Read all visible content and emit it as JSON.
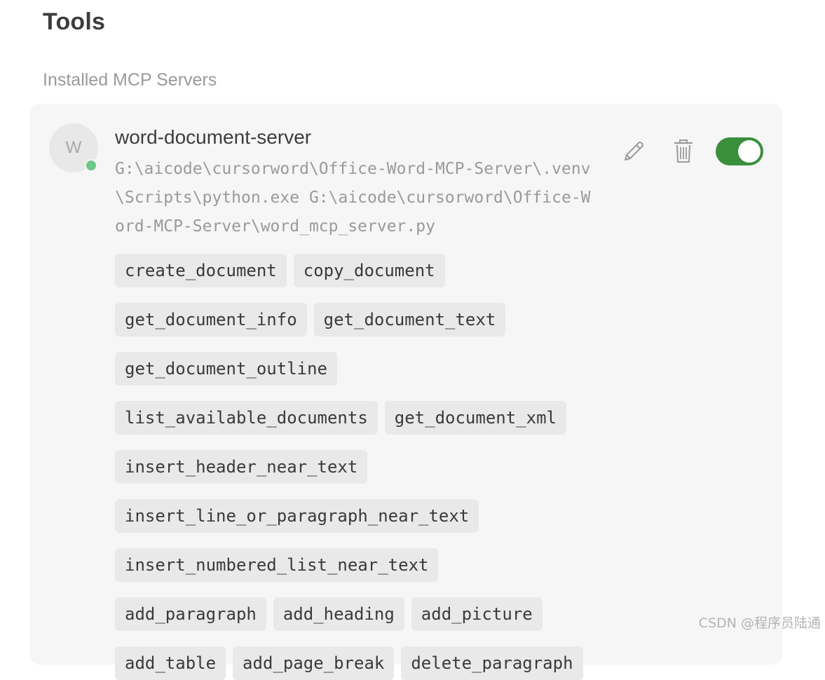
{
  "page": {
    "title": "Tools",
    "section_label": "Installed MCP Servers"
  },
  "server": {
    "avatar_letter": "W",
    "status": "online",
    "name": "word-document-server",
    "command": "G:\\aicode\\cursorword\\Office-Word-MCP-Server\\.venv\\Scripts\\python.exe G:\\aicode\\cursorword\\Office-Word-MCP-Server\\word_mcp_server.py",
    "enabled": true,
    "actions": {
      "edit_icon": "pencil-icon",
      "delete_icon": "trash-icon"
    },
    "tools": [
      "create_document",
      "copy_document",
      "get_document_info",
      "get_document_text",
      "get_document_outline",
      "list_available_documents",
      "get_document_xml",
      "insert_header_near_text",
      "insert_line_or_paragraph_near_text",
      "insert_numbered_list_near_text",
      "add_paragraph",
      "add_heading",
      "add_picture",
      "add_table",
      "add_page_break",
      "delete_paragraph"
    ]
  },
  "colors": {
    "toggle_on": "#3a8f3c",
    "status_online": "#6cc889",
    "card_background": "#f6f6f6",
    "chip_background": "#e9e9e9"
  },
  "watermark": "CSDN @程序员陆通"
}
